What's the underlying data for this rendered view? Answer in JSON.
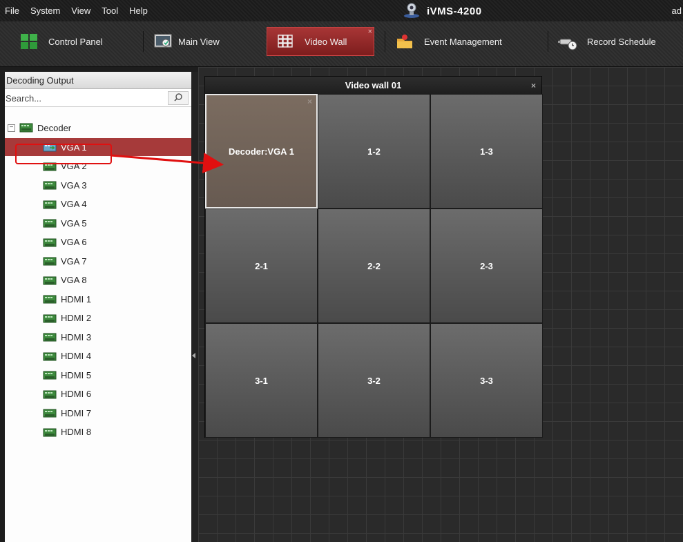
{
  "menubar": {
    "items": [
      "File",
      "System",
      "View",
      "Tool",
      "Help"
    ],
    "app_title": "iVMS-4200",
    "user": "ad"
  },
  "tabs": [
    {
      "label": "Control Panel",
      "icon": "control-panel-icon"
    },
    {
      "label": "Main View",
      "icon": "main-view-icon"
    },
    {
      "label": "Video Wall",
      "icon": "video-wall-icon",
      "active": true,
      "close": "×"
    },
    {
      "label": "Event Management",
      "icon": "event-management-icon"
    },
    {
      "label": "Record Schedule",
      "icon": "record-schedule-icon"
    }
  ],
  "sidebar": {
    "header": "Decoding Output",
    "search_placeholder": "Search...",
    "root": {
      "label": "Decoder",
      "collapse_symbol": "−"
    },
    "items": [
      "VGA 1",
      "VGA 2",
      "VGA 3",
      "VGA 4",
      "VGA 5",
      "VGA 6",
      "VGA 7",
      "VGA 8",
      "HDMI 1",
      "HDMI 2",
      "HDMI 3",
      "HDMI 4",
      "HDMI 5",
      "HDMI 6",
      "HDMI 7",
      "HDMI 8"
    ],
    "selected": "VGA 1"
  },
  "wall": {
    "title": "Video wall 01",
    "close": "×",
    "cells": [
      "Decoder:VGA 1",
      "1-2",
      "1-3",
      "2-1",
      "2-2",
      "2-3",
      "3-1",
      "3-2",
      "3-3"
    ],
    "cell_close": "×"
  },
  "colors": {
    "accent": "#a63a3a",
    "annotation": "#e01010"
  }
}
